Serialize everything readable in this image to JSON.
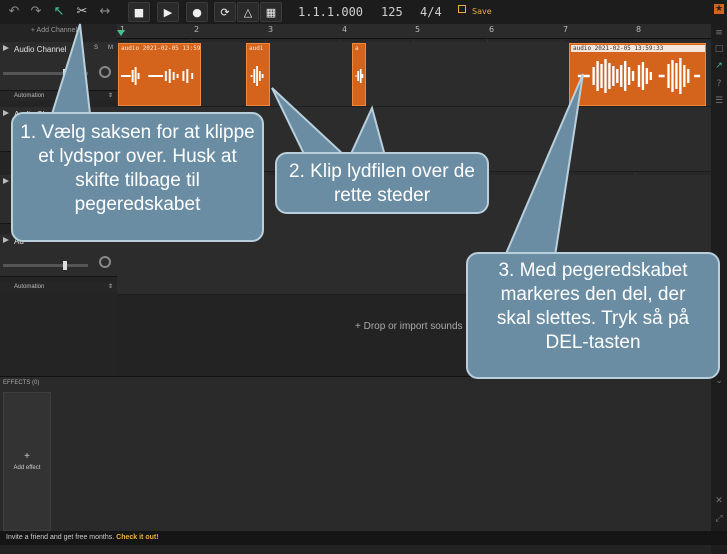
{
  "toolbar": {
    "position": "1.1.1.000",
    "tempo": "125",
    "time_signature": "4/4",
    "save_label": "Save",
    "accent_color": "#e8b23a"
  },
  "ruler": {
    "bars": [
      "1",
      "2",
      "3",
      "4",
      "5",
      "6",
      "7",
      "8"
    ]
  },
  "tracks": {
    "add_channel_label": "+ Add Channel",
    "items": [
      {
        "name": "Audio Channel",
        "mute": "M",
        "solo": "S",
        "automation_label": "Automation"
      },
      {
        "name": "Audio Ch",
        "automation_label": "Automation"
      },
      {
        "name": "Au",
        "automation_label": "Automation"
      },
      {
        "name": "Au",
        "automation_label": "Automation"
      }
    ]
  },
  "clips": [
    {
      "label": "audio 2021-02-05 13:59"
    },
    {
      "label": "audi"
    },
    {
      "label": "a"
    },
    {
      "label": "audio 2021-02-05 13:59:33"
    }
  ],
  "drop_hint": "+ Drop or import sounds",
  "effects": {
    "title": "EFFECTS (0)",
    "add_effect_plus": "+",
    "add_effect_label": "Add effect"
  },
  "footer": {
    "text": "Invite a friend and get free months.",
    "link": "Check it out!"
  },
  "callouts": {
    "one": "1. Vælg saksen for at klippe et lydspor over. Husk at skifte tilbage til pegeredskabet",
    "two": "2. Klip lydfilen over de rette steder",
    "three": "3. Med pegeredskabet markeres den del, der skal slettes. Tryk så på DEL-tasten"
  },
  "icons": {
    "undo": "undo-icon",
    "redo": "redo-icon",
    "pointer": "pointer-icon",
    "scissors": "scissors-icon",
    "stretch": "stretch-icon",
    "stop": "stop-icon",
    "play": "play-icon",
    "record": "record-icon",
    "loop": "loop-icon",
    "metronome": "metronome-icon",
    "keyboard": "keyboard-icon",
    "save": "save-icon"
  },
  "colors": {
    "clip": "#d4631c",
    "callout_fill": "#6a8da3",
    "callout_border": "#b9cfdb"
  }
}
